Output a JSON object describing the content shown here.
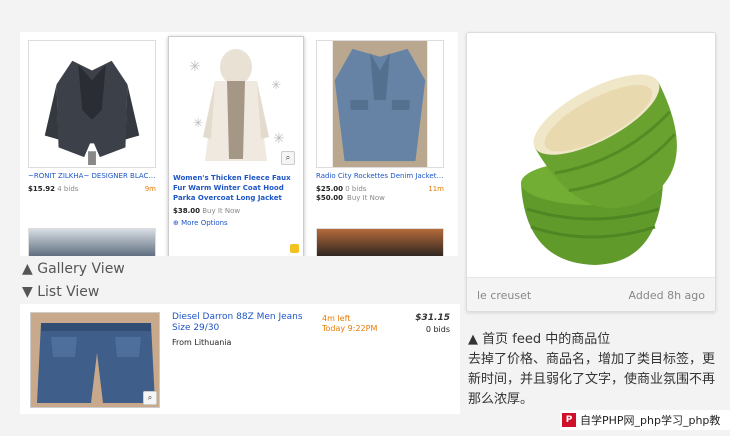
{
  "gallery": {
    "items": [
      {
        "title": "~RONIT ZILKHA~ DESIGNER BLACK...",
        "price": "$15.92",
        "bids": "4 bids",
        "time": "9m"
      },
      {
        "title": "Women's Thicken Fleece Faux Fur Warm Winter Coat Hood Parka Overcoat Long Jacket",
        "price": "$38.00",
        "buy_now": "Buy It Now",
        "more_options": "More Options"
      },
      {
        "title": "Radio City Rockettes Denim Jacket ...",
        "price": "$25.00",
        "bids": "0 bids",
        "time": "11m",
        "price2": "$50.00",
        "buy_now": "Buy It Now"
      }
    ],
    "label": "▲ Gallery View"
  },
  "list_view": {
    "label": "▼  List View",
    "item": {
      "title": "Diesel Darron 88Z Men Jeans Size 29/30",
      "origin": "From Lithuania",
      "time_left": "4m left",
      "end_time": "Today 9:22PM",
      "price": "$31.15",
      "bids": "0 bids"
    }
  },
  "feed_card": {
    "brand": "le creuset",
    "added": "Added 8h ago"
  },
  "caption": {
    "title": "▲ 首页 feed 中的商品位",
    "body": "去掉了价格、商品名，增加了类目标签，更新时间，并且弱化了文字，使商业氛围不再那么浓厚。"
  },
  "watermark": {
    "icon": "P",
    "text": "自学PHP网_php学习_php教"
  },
  "colors": {
    "link": "#1e56c5",
    "time": "#e87b06",
    "bowl_green": "#6aa22f"
  }
}
